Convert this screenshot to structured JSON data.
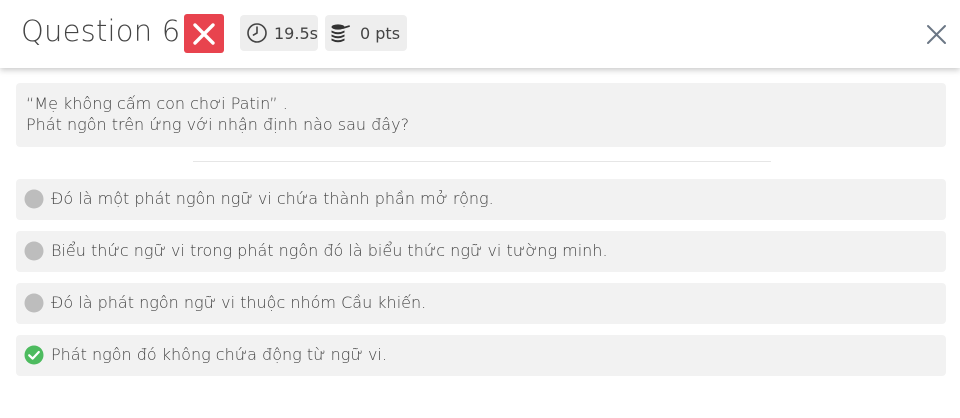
{
  "header": {
    "title": "Question 6",
    "result_icon": "wrong-x-icon",
    "timer": {
      "icon": "clock-icon",
      "value": "19.5s"
    },
    "points": {
      "icon": "coins-icon",
      "value": "0 pts"
    },
    "close_icon": "close-icon"
  },
  "question": {
    "line1": "“Mẹ không cấm con chơi Patin” .",
    "line2": "Phát ngôn trên ứng với nhận định nào sau đây?"
  },
  "answers": [
    {
      "text": "Đó là một phát ngôn ngữ vi chứa thành phần mở rộng.",
      "state": "neutral",
      "icon": "grey-circle-icon"
    },
    {
      "text": "Biểu thức ngữ vi trong phát ngôn đó là biểu thức ngữ vi tường minh.",
      "state": "neutral",
      "icon": "grey-circle-icon"
    },
    {
      "text": "Đó là phát ngôn ngữ vi thuộc nhóm Cầu khiến.",
      "state": "neutral",
      "icon": "grey-circle-icon"
    },
    {
      "text": "Phát ngôn đó không chứa động từ ngữ vi.",
      "state": "correct",
      "icon": "green-check-circle-icon"
    }
  ],
  "colors": {
    "wrong": "#e8434e",
    "correct": "#4dbb5f",
    "neutral_marker": "#bdbdbd",
    "answer_bg": "#f2f2f2"
  }
}
